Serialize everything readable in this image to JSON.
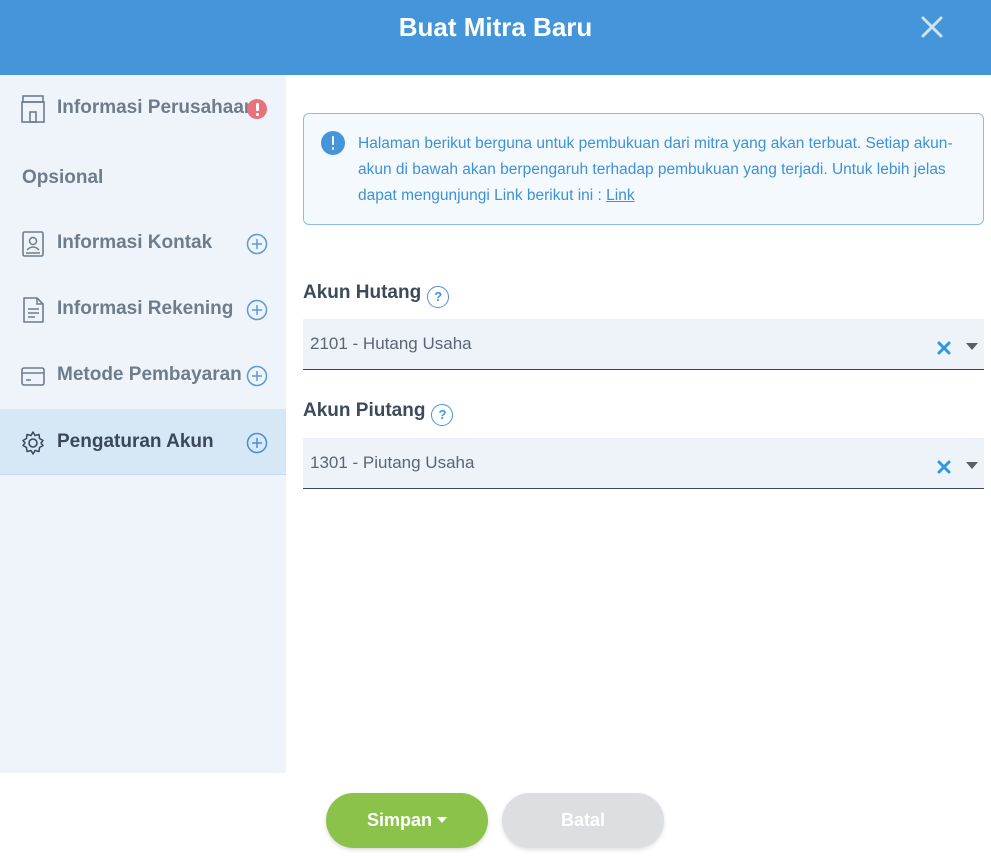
{
  "header": {
    "title": "Buat Mitra Baru"
  },
  "sidebar": {
    "items": [
      {
        "label": "Informasi Perusahaan",
        "icon": "building-icon",
        "status": "warning"
      },
      {
        "label": "Informasi Kontak",
        "icon": "contact-book-icon"
      },
      {
        "label": "Informasi Rekening",
        "icon": "document-icon"
      },
      {
        "label": "Metode Pembayaran",
        "icon": "card-icon"
      },
      {
        "label": "Pengaturan Akun",
        "icon": "gear-icon",
        "active": true
      }
    ],
    "section_label": "Opsional"
  },
  "info": {
    "text": "Halaman berikut berguna untuk pembukuan dari mitra yang akan terbuat. Setiap akun-akun di bawah akan berpengaruh terhadap pembukuan yang terjadi. Untuk lebih jelas dapat mengunjungi Link berikut ini : ",
    "link": "Link"
  },
  "fields": {
    "hutang": {
      "label": "Akun Hutang",
      "help": "?",
      "value": "2101 - Hutang Usaha"
    },
    "piutang": {
      "label": "Akun Piutang",
      "help": "?",
      "value": "1301 - Piutang Usaha"
    }
  },
  "buttons": {
    "save": "Simpan",
    "cancel": "Batal"
  },
  "colors": {
    "header": "#4495d9",
    "save": "#8bc34a",
    "warning": "#e8717b"
  }
}
